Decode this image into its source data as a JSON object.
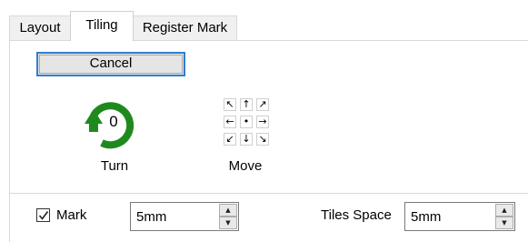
{
  "tabs": [
    {
      "label": "Layout",
      "active": false
    },
    {
      "label": "Tiling",
      "active": true
    },
    {
      "label": "Register Mark",
      "active": false
    }
  ],
  "cancel_label": "Cancel",
  "turn": {
    "value": "0",
    "label": "Turn",
    "icon": "rotate-clockwise-icon",
    "color": "#1e8a1e"
  },
  "move": {
    "label": "Move",
    "arrows": [
      "↖",
      "↑",
      "↗",
      "←",
      "•",
      "→",
      "↙",
      "↓",
      "↘"
    ]
  },
  "mark": {
    "label": "Mark",
    "checked": true,
    "value": "5mm"
  },
  "tiles_space": {
    "label": "Tiles Space",
    "value": "5mm"
  }
}
